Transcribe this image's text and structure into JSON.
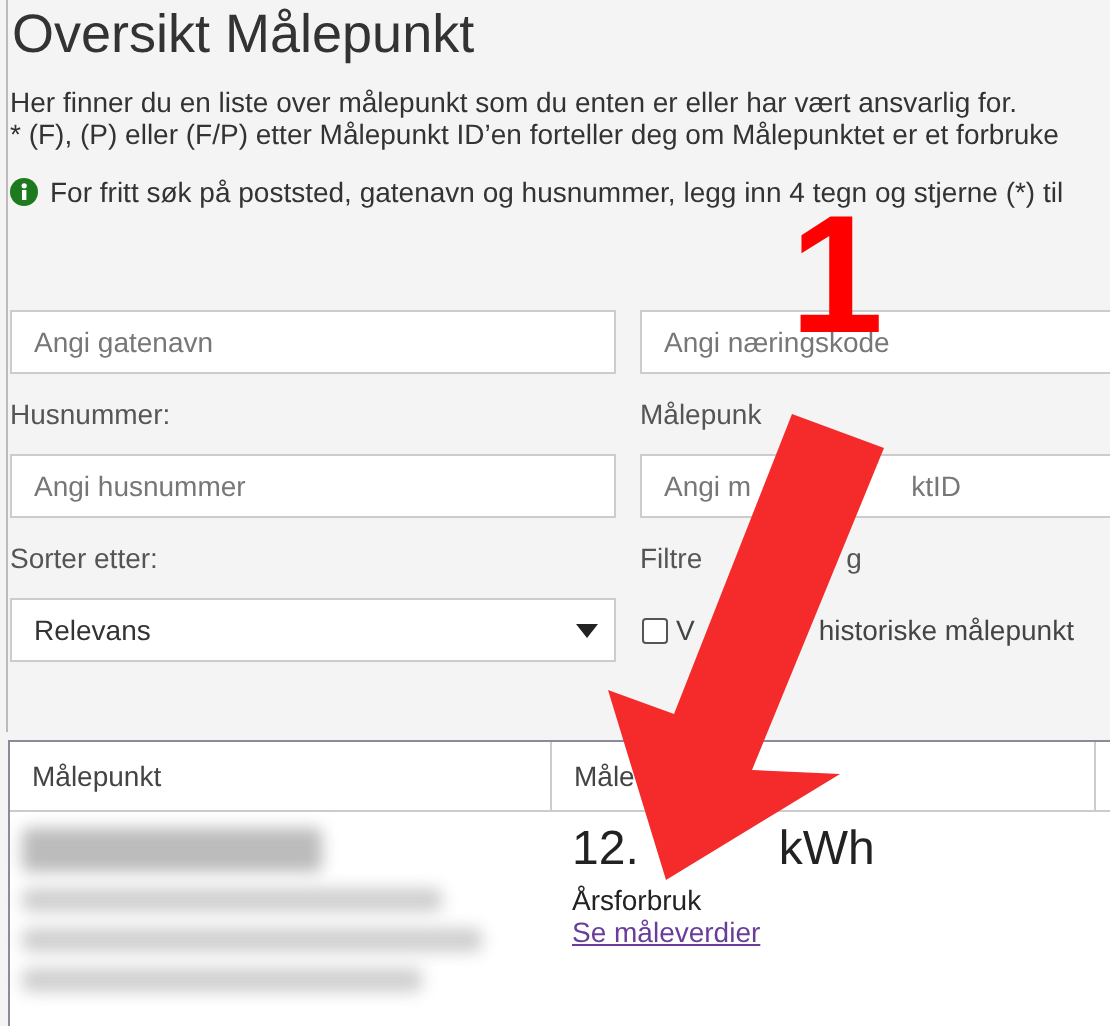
{
  "page": {
    "title": "Oversikt Målepunkt",
    "intro": [
      "Her finner du en liste over målepunkt som du enten er eller har vært ansvarlig for.",
      "* (F), (P) eller (F/P) etter Målepunkt ID’en forteller deg om Målepunktet er et forbruke"
    ],
    "info": "For fritt søk på poststed, gatenavn og husnummer, legg inn 4 tegn og stjerne (*) til"
  },
  "fields": [
    {
      "kind": "input",
      "placeholder": [
        "Angi gatenavn"
      ]
    },
    {
      "kind": "input",
      "placeholder": [
        "Angi næringskode"
      ]
    },
    {
      "kind": "input",
      "label": [
        "Husnummer:"
      ],
      "placeholder": [
        "Angi husnummer"
      ]
    },
    {
      "kind": "input",
      "label": [
        "Målepunk"
      ],
      "placeholder": [
        "Angi m",
        "ktID"
      ]
    },
    {
      "kind": "select",
      "label": [
        "Sorter etter:"
      ],
      "value": "Relevans"
    },
    {
      "kind": "checkbox",
      "label": [
        "Filtre",
        "g"
      ],
      "option": [
        "V",
        "historiske målepunkt"
      ],
      "checked": false
    }
  ],
  "table": {
    "columns": [
      [
        "Målepunkt"
      ],
      [
        "Måle"
      ]
    ],
    "rows": [
      {
        "reading": [
          "12.",
          "kWh"
        ],
        "caption": "Årsforbruk",
        "link": "Se måleverdier"
      }
    ]
  },
  "annotation": {
    "number": "1"
  }
}
